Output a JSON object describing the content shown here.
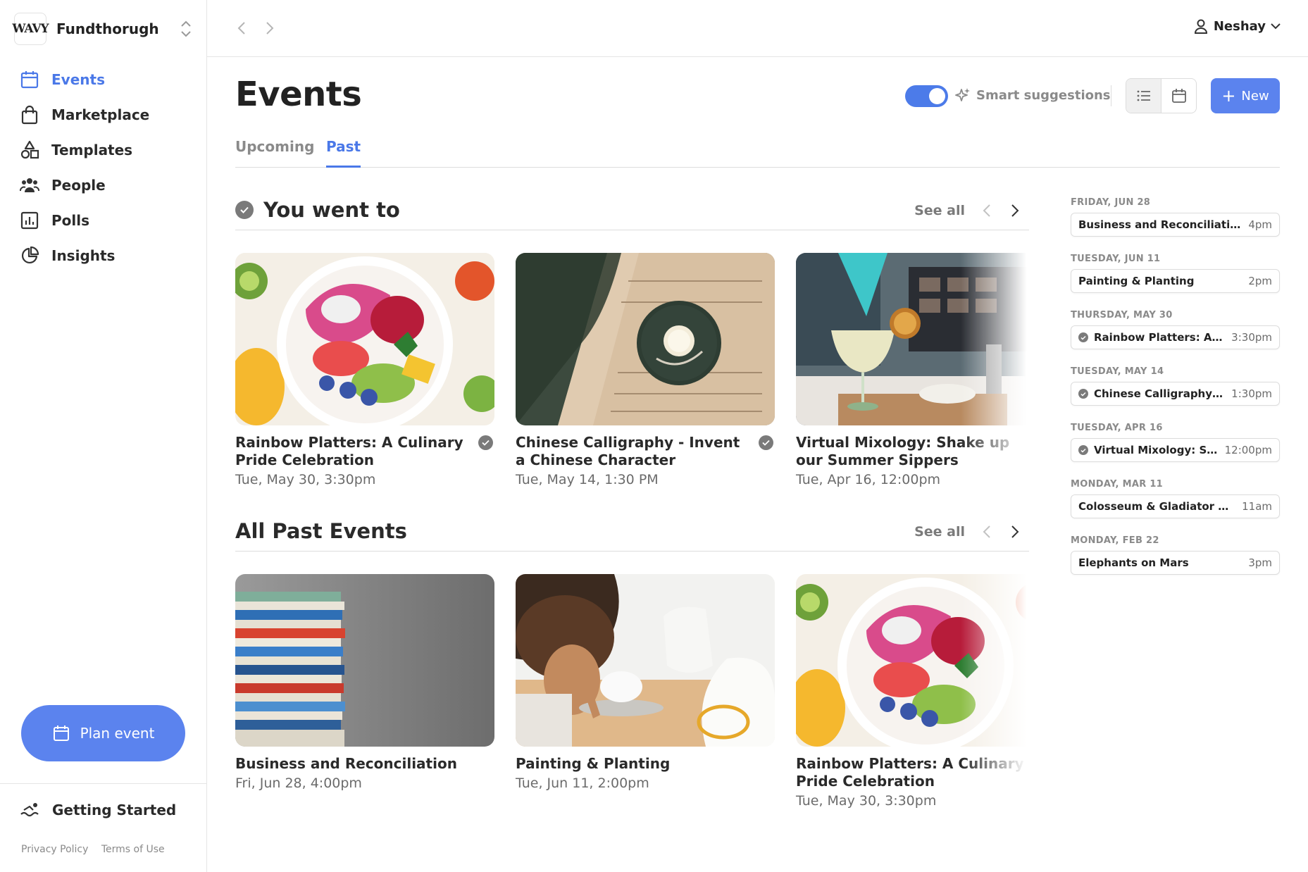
{
  "org": {
    "logo_text": "WAVY",
    "name": "Fundthorugh"
  },
  "nav": {
    "items": [
      {
        "label": "Events"
      },
      {
        "label": "Marketplace"
      },
      {
        "label": "Templates"
      },
      {
        "label": "People"
      },
      {
        "label": "Polls"
      },
      {
        "label": "Insights"
      }
    ]
  },
  "plan_event_label": "Plan event",
  "getting_started_label": "Getting Started",
  "footer": {
    "privacy": "Privacy Policy",
    "terms": "Terms of Use"
  },
  "user": {
    "name": "Neshay"
  },
  "page": {
    "title": "Events"
  },
  "smart_suggestions": {
    "label": "Smart suggestions",
    "enabled": true
  },
  "new_button_label": "New",
  "tabs": [
    {
      "label": "Upcoming"
    },
    {
      "label": "Past"
    }
  ],
  "sections": {
    "went_to": {
      "title": "You went to",
      "see_all": "See all",
      "cards": [
        {
          "title": "Rainbow Platters: A Culinary Pride Celebration",
          "date": "Tue, May 30, 3:30pm",
          "attended": true
        },
        {
          "title": "Chinese Calligraphy - Invent a Chinese Character",
          "date": "Tue, May 14, 1:30 PM",
          "attended": true
        },
        {
          "title": "Virtual Mixology: Shake up our Summer Sippers",
          "date": "Tue, Apr 16, 12:00pm",
          "attended": false
        }
      ]
    },
    "all_past": {
      "title": "All Past Events",
      "see_all": "See all",
      "cards": [
        {
          "title": "Business and Reconciliation",
          "date": "Fri, Jun 28, 4:00pm"
        },
        {
          "title": "Painting & Planting",
          "date": "Tue, Jun 11, 2:00pm"
        },
        {
          "title": "Rainbow Platters: A Culinary Pride Celebration",
          "date": "Tue, May 30, 3:30pm"
        }
      ]
    }
  },
  "timeline": [
    {
      "date": "FRIDAY, JUN 28",
      "name": "Business and Reconciliation...",
      "time": "4pm",
      "attended": false
    },
    {
      "date": "TUESDAY, JUN 11",
      "name": "Painting & Planting",
      "time": "2pm",
      "attended": false
    },
    {
      "date": "THURSDAY, MAY 30",
      "name": "Rainbow Platters: A Culi...",
      "time": "3:30pm",
      "attended": true
    },
    {
      "date": "TUESDAY, MAY 14",
      "name": "Chinese Calligraphy - Inv...",
      "time": "1:30pm",
      "attended": true
    },
    {
      "date": "TUESDAY, APR 16",
      "name": "Virtual Mixology: Shake...",
      "time": "12:00pm",
      "attended": true
    },
    {
      "date": "MONDAY, MAR 11",
      "name": "Colosseum & Gladiator Arena...",
      "time": "11am",
      "attended": false
    },
    {
      "date": "MONDAY, FEB 22",
      "name": "Elephants on Mars",
      "time": "3pm",
      "attended": false
    }
  ],
  "colors": {
    "accent": "#4a78e8",
    "button": "#5b83ee",
    "muted": "#8a8a8a"
  }
}
